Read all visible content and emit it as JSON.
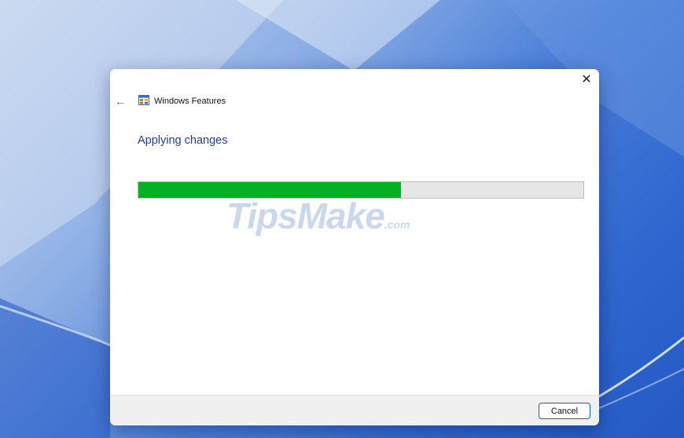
{
  "dialog": {
    "title": "Windows Features",
    "back_symbol": "←",
    "close_symbol": "✕",
    "heading": "Applying changes",
    "progress": 0.59,
    "watermark": "TipsMake",
    "watermark_suffix": ".com",
    "cancel_label": "Cancel",
    "icon": "windows-features-icon"
  },
  "colors": {
    "accent_heading": "#1f3e98",
    "progress_fill": "#06b025",
    "progress_track": "#e6e6e6",
    "button_border": "#0067c0"
  }
}
